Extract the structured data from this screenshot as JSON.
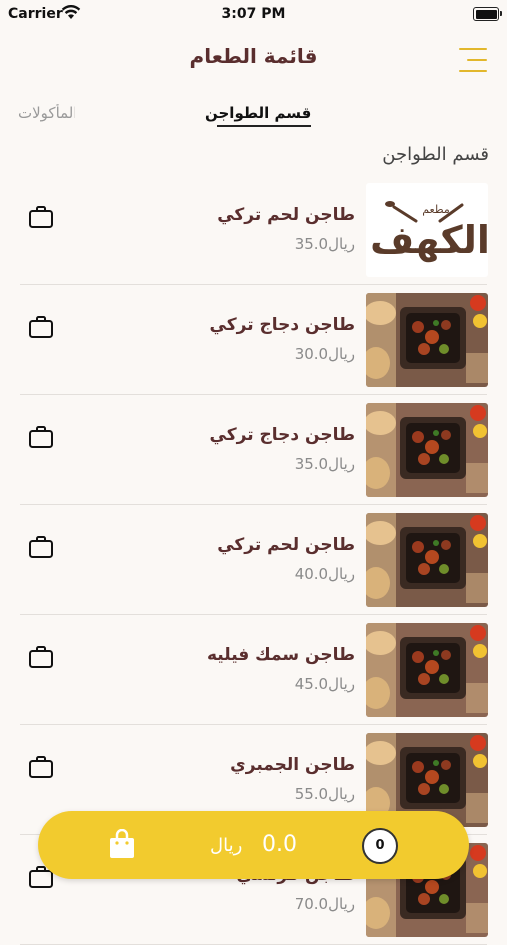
{
  "status_bar": {
    "carrier": "Carrier",
    "time": "3:07 PM"
  },
  "nav": {
    "title": "قائمة الطعام"
  },
  "tabs": [
    {
      "label": "قسم الطواجن",
      "active": true
    },
    {
      "label": "قسم المأكولات",
      "active": false
    }
  ],
  "section": {
    "title": "قسم الطواجن"
  },
  "items": [
    {
      "name": "طاجن لحم تركي",
      "price": "35.0ريال",
      "image": "restaurant-logo"
    },
    {
      "name": "طاجن دجاج تركي",
      "price": "30.0ريال",
      "image": "food-photo"
    },
    {
      "name": "طاجن دجاج تركي",
      "price": "35.0ريال",
      "image": "food-photo"
    },
    {
      "name": "طاجن لحم تركي",
      "price": "40.0ريال",
      "image": "food-photo"
    },
    {
      "name": "طاجن سمك فيليه",
      "price": "45.0ريال",
      "image": "food-photo"
    },
    {
      "name": "طاجن الجمبري",
      "price": "55.0ريال",
      "image": "food-photo"
    },
    {
      "name": "طاجن فرنسي",
      "price": "70.0ريال",
      "image": "food-photo"
    }
  ],
  "logo": {
    "top_text": "مطعم",
    "main_text": "الكهف"
  },
  "cart": {
    "total": "0.0",
    "currency": "ريال",
    "count": "0"
  },
  "colors": {
    "accent": "#f2cb2e",
    "title": "#5a2e2e",
    "background": "#fbf8f5"
  }
}
